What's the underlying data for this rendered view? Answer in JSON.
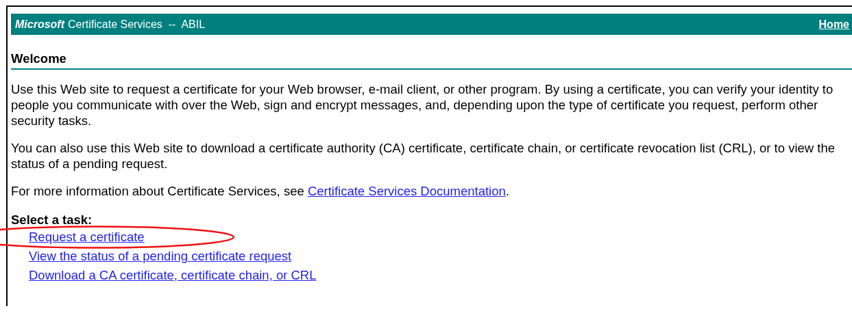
{
  "banner": {
    "brand": "Microsoft",
    "title": "Certificate Services  --  ABIL",
    "home_link": "Home"
  },
  "heading": "Welcome",
  "paragraphs": [
    "Use this Web site to request a certificate for your Web browser, e-mail client, or other program. By using a certificate, you can verify your identity to people you communicate with over the Web, sign and encrypt messages, and, depending upon the type of certificate you request, perform other security tasks.",
    "You can also use this Web site to download a certificate authority (CA) certificate, certificate chain, or certificate revocation list (CRL), or to view the status of a pending request."
  ],
  "info": {
    "text": "For more information about Certificate Services, see ",
    "link": "Certificate Services Documentation",
    "after": "."
  },
  "tasks": {
    "label": "Select a task:",
    "links": [
      "Request a certificate",
      "View the status of a pending certificate request",
      "Download a CA certificate, certificate chain, or CRL"
    ]
  }
}
